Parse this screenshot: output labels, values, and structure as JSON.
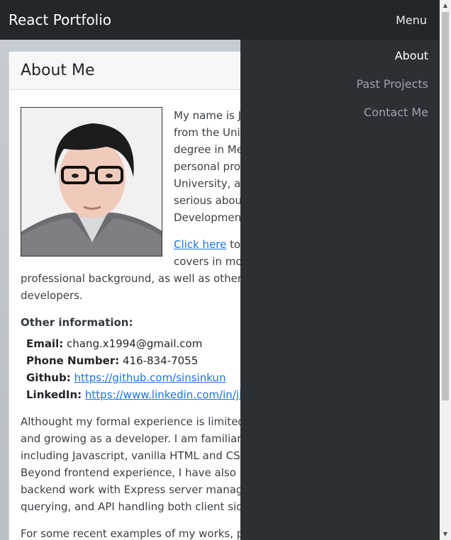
{
  "navbar": {
    "brand": "React Portfolio",
    "menu_label": "Menu"
  },
  "drawer": {
    "items": [
      "About",
      "Past Projects",
      "Contact Me"
    ],
    "active": "About"
  },
  "card": {
    "title": "About Me",
    "intro_lines": [
      "My name is Ji",
      "from the Univ",
      "degree in Me",
      "personal proj",
      "University, an",
      "serious about",
      "Development"
    ],
    "click_link": "Click here",
    "click_rest_1": " to",
    "click_rest_2": "covers in mor",
    "click_rest_3": "professional background, as well as other sk",
    "click_rest_4": "developers.",
    "other_heading": "Other information:",
    "info": {
      "email_label": "Email:",
      "email_value": " chang.x1994@gmail.com",
      "phone_label": "Phone Number:",
      "phone_value": " 416-834-7055",
      "github_label": "Github:",
      "github_value": "https://github.com/sinsinkun",
      "linkedin_label": "LinkedIn:",
      "linkedin_value": "https://www.linkedin.com/in/jing"
    },
    "para2_lines": [
      "Althought my formal experience is limited, I",
      "and growing as a developer. I am familiar wi",
      "including Javascript, vanilla HTML and CSS, F",
      "Beyond frontend experience, I have also had",
      "backend work with Express server managem",
      "querying, and API handling both client side a"
    ],
    "para3": "For some recent examples of my works, plea"
  },
  "scrollbar": {
    "up": "▲",
    "down": "▼"
  }
}
